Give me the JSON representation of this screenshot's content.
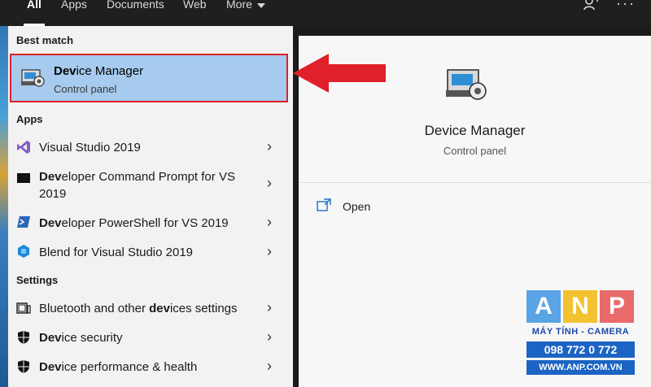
{
  "tabs": [
    {
      "label": "All",
      "active": true
    },
    {
      "label": "Apps",
      "active": false
    },
    {
      "label": "Documents",
      "active": false
    },
    {
      "label": "Web",
      "active": false
    },
    {
      "label": "More",
      "active": false
    }
  ],
  "topbar_icons": [
    "feedback-icon",
    "more-options-icon"
  ],
  "sections": {
    "best_match": "Best match",
    "apps": "Apps",
    "settings": "Settings"
  },
  "best_match": {
    "title_bold": "Dev",
    "title_rest": "ice Manager",
    "subtitle": "Control panel",
    "icon": "device-manager-icon"
  },
  "apps": [
    {
      "bold": "",
      "rest": "Visual Studio 2019",
      "icon": "visual-studio-icon"
    },
    {
      "bold": "Dev",
      "rest": "eloper Command Prompt for VS",
      "rest2": "2019",
      "icon": "command-prompt-icon"
    },
    {
      "bold": "Dev",
      "rest": "eloper PowerShell for VS 2019",
      "icon": "powershell-icon"
    },
    {
      "bold": "",
      "rest": "Blend for Visual Studio 2019",
      "icon": "blend-icon"
    }
  ],
  "settings": [
    {
      "pre": "Bluetooth and other ",
      "bold": "dev",
      "rest": "ices settings",
      "icon": "bluetooth-devices-icon"
    },
    {
      "pre": "",
      "bold": "Dev",
      "rest": "ice security",
      "icon": "shield-icon"
    },
    {
      "pre": "",
      "bold": "Dev",
      "rest": "ice performance & health",
      "icon": "shield-icon"
    }
  ],
  "preview": {
    "title": "Device Manager",
    "subtitle": "Control panel",
    "action_open": "Open"
  },
  "watermark": {
    "letters": [
      "A",
      "N",
      "P"
    ],
    "letter_colors": [
      "#5aa3e6",
      "#f2c230",
      "#e86a6a"
    ],
    "tagline": "MÁY TÍNH - CAMERA",
    "phone": "098 772 0 772",
    "site": "WWW.ANP.COM.VN"
  },
  "colors": {
    "highlight": "#a6cbee",
    "annotation_red": "#e0202a"
  }
}
